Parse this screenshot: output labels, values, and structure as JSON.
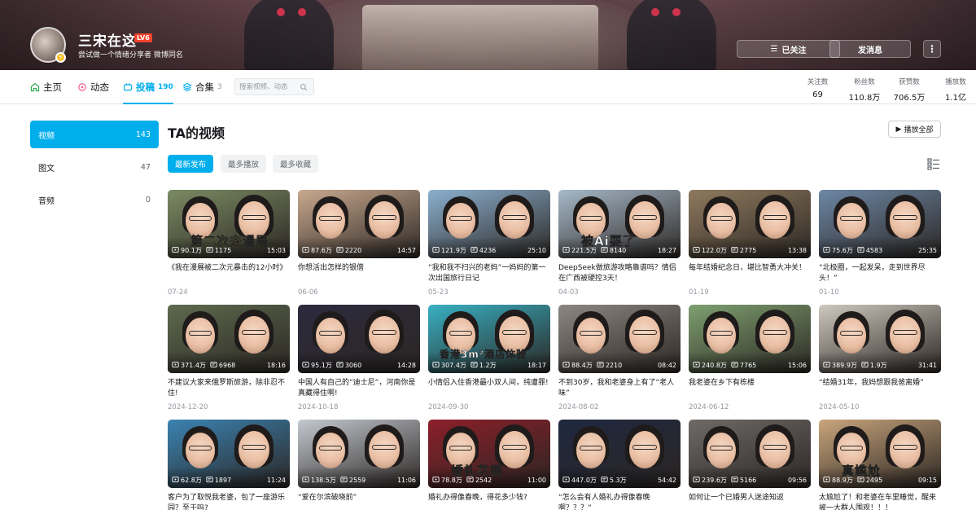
{
  "profile": {
    "name": "三宋在这",
    "level": "LV6",
    "sign": "尝试做一个情绪分享者 微博同名",
    "follow_label": "已关注",
    "message_label": "发消息",
    "more_label": "⋮"
  },
  "nav": {
    "tabs": [
      {
        "label": "主页",
        "count": ""
      },
      {
        "label": "动态",
        "count": ""
      },
      {
        "label": "投稿",
        "count": "190"
      },
      {
        "label": "合集",
        "count": "3"
      }
    ],
    "search_placeholder": "搜索视频、动态"
  },
  "stats": [
    {
      "label": "关注数",
      "value": "69"
    },
    {
      "label": "粉丝数",
      "value": "110.8万"
    },
    {
      "label": "获赞数",
      "value": "706.5万"
    },
    {
      "label": "播放数",
      "value": "1.1亿"
    }
  ],
  "sidebar": [
    {
      "label": "视频",
      "count": "143"
    },
    {
      "label": "图文",
      "count": "47"
    },
    {
      "label": "音频",
      "count": "0"
    }
  ],
  "main": {
    "title": "TA的视频",
    "play_all": "播放全部",
    "sort": [
      "最新发布",
      "最多播放",
      "最多收藏"
    ]
  },
  "videos": [
    {
      "plays": "90.1万",
      "comments": "1175",
      "duration": "15:03",
      "title": "《我在漫展被二次元暴击的12小时》",
      "date": "07-24",
      "caption": "第二次去漫展",
      "caption_color": "#f5e03a",
      "bg": "#7b8b63"
    },
    {
      "plays": "87.6万",
      "comments": "2220",
      "duration": "14:57",
      "title": "你想活出怎样的银僧",
      "date": "06-06",
      "caption": "",
      "caption_color": "#ffffff",
      "bg": "#c9a98f"
    },
    {
      "plays": "121.9万",
      "comments": "4236",
      "duration": "25:10",
      "title": "“我和我不扫兴的老妈”一妈妈的第一次出国旅行日记",
      "date": "05-23",
      "caption": "",
      "caption_color": "#ffffff",
      "bg": "#8bb0cf"
    },
    {
      "plays": "221.5万",
      "comments": "8140",
      "duration": "18:27",
      "title": "DeepSeek做旅游攻略靠谱吗？情侣在广西被硬控3天！",
      "date": "04-03",
      "caption": "被Ai耍了",
      "caption_color": "#ffffff",
      "bg": "#a7b9c9"
    },
    {
      "plays": "122.0万",
      "comments": "2775",
      "duration": "13:38",
      "title": "每年结婚纪念日，堪比智勇大冲关！",
      "date": "01-19",
      "caption": "",
      "caption_color": "#ffffff",
      "bg": "#8f7a5e"
    },
    {
      "plays": "75.6万",
      "comments": "4583",
      "duration": "25:35",
      "title": "“北极圈，一起发呆，走到世界尽头！”",
      "date": "01-10",
      "caption": "",
      "caption_color": "#ffffff",
      "bg": "#6d87a5"
    },
    {
      "plays": "371.4万",
      "comments": "6968",
      "duration": "18:16",
      "title": "不建议大家来俄罗斯旅游，除非忍不住!",
      "date": "2024-12-20",
      "caption": "",
      "caption_color": "#ffffff",
      "bg": "#5e6a4e"
    },
    {
      "plays": "95.1万",
      "comments": "3060",
      "duration": "14:28",
      "title": "中国人有自己的“迪士尼”，河南你是真藏得住啊!",
      "date": "2024-10-18",
      "caption": "",
      "caption_color": "#ffffff",
      "bg": "#2c2b3e"
    },
    {
      "plays": "307.4万",
      "comments": "1.2万",
      "duration": "18:17",
      "title": "小情侣入住香港最小双人间，纯遭罪!",
      "date": "2024-09-30",
      "caption": "香港3m²酒店体验",
      "caption_color": "#ffffff",
      "bg": "#38b0c2"
    },
    {
      "plays": "88.4万",
      "comments": "2210",
      "duration": "08:42",
      "title": "不到30岁，我和老婆身上有了“老人味”",
      "date": "2024-08-02",
      "caption": "",
      "caption_color": "#ffffff",
      "bg": "#8d8782"
    },
    {
      "plays": "240.8万",
      "comments": "7765",
      "duration": "15:06",
      "title": "我老婆在乡下有栋楼",
      "date": "2024-06-12",
      "caption": "",
      "caption_color": "#ffffff",
      "bg": "#7ea070"
    },
    {
      "plays": "389.9万",
      "comments": "1.9万",
      "duration": "31:41",
      "title": "“结婚31年，我妈想跟我爸离婚”",
      "date": "2024-05-10",
      "caption": "",
      "caption_color": "#ffffff",
      "bg": "#cfc8bf"
    },
    {
      "plays": "62.8万",
      "comments": "1897",
      "duration": "11:24",
      "title": "客户为了取悦我老婆，包了一座游乐园？至于吗?",
      "date": "",
      "caption": "",
      "caption_color": "#ffffff",
      "bg": "#3b83b2"
    },
    {
      "plays": "138.5万",
      "comments": "2559",
      "duration": "11:06",
      "title": "“爱在尔滨破晓前”",
      "date": "",
      "caption": "",
      "caption_color": "#ffffff",
      "bg": "#c4c9d0"
    },
    {
      "plays": "78.8万",
      "comments": "2542",
      "duration": "11:00",
      "title": "婚礼办得像春晚，得花多少钱?",
      "date": "",
      "caption": "婚礼花销",
      "caption_color": "#f7d93a",
      "bg": "#8c1f2a"
    },
    {
      "plays": "447.0万",
      "comments": "5.3万",
      "duration": "54:42",
      "title": "“怎么会有人婚礼办得像春晚啊？？？”",
      "date": "",
      "caption": "",
      "caption_color": "#ffffff",
      "bg": "#1f2840"
    },
    {
      "plays": "239.6万",
      "comments": "5166",
      "duration": "09:56",
      "title": "如何让一个已婚男人迷途知返",
      "date": "",
      "caption": "",
      "caption_color": "#ffffff",
      "bg": "#6e6a68"
    },
    {
      "plays": "88.9万",
      "comments": "2495",
      "duration": "09:15",
      "title": "太尴尬了！和老婆在车里睡觉，醒来被一大群人围观！！！",
      "date": "",
      "caption": "真尴尬",
      "caption_color": "#f7e13d",
      "bg": "#c9a57c"
    }
  ]
}
